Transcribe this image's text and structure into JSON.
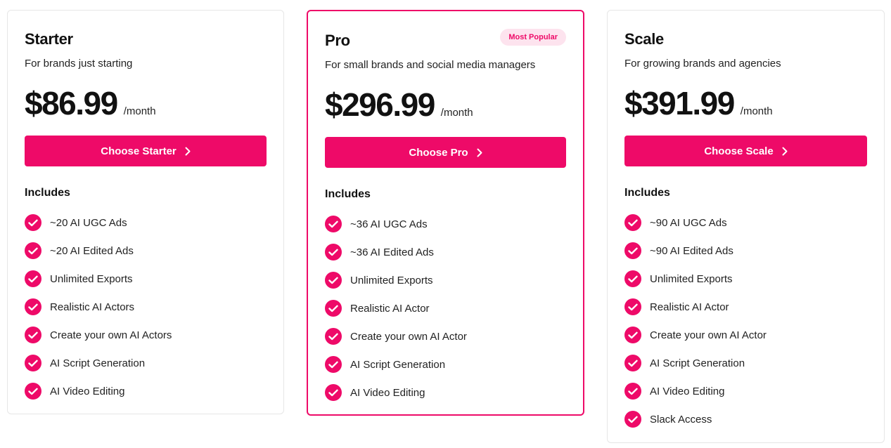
{
  "colors": {
    "accent": "#ee0a68",
    "badge_bg": "#fde3ee"
  },
  "includes_label": "Includes",
  "plans": [
    {
      "name": "Starter",
      "description": "For brands just starting",
      "price": "$86.99",
      "period": "/month",
      "cta": "Choose Starter",
      "features": [
        "~20 AI UGC Ads",
        "~20 AI Edited Ads",
        "Unlimited Exports",
        "Realistic AI Actors",
        "Create your own AI Actors",
        "AI Script Generation",
        "AI Video Editing"
      ]
    },
    {
      "name": "Pro",
      "badge": "Most Popular",
      "description": "For small brands and social media managers",
      "price": "$296.99",
      "period": "/month",
      "cta": "Choose Pro",
      "features": [
        "~36 AI UGC Ads",
        "~36 AI Edited Ads",
        "Unlimited Exports",
        "Realistic AI Actor",
        "Create your own AI Actor",
        "AI Script Generation",
        "AI Video Editing"
      ]
    },
    {
      "name": "Scale",
      "description": "For growing brands and agencies",
      "price": "$391.99",
      "period": "/month",
      "cta": "Choose Scale",
      "features": [
        "~90 AI UGC Ads",
        "~90 AI Edited Ads",
        "Unlimited Exports",
        "Realistic AI Actor",
        "Create your own AI Actor",
        "AI Script Generation",
        "AI Video Editing",
        "Slack Access"
      ]
    }
  ]
}
